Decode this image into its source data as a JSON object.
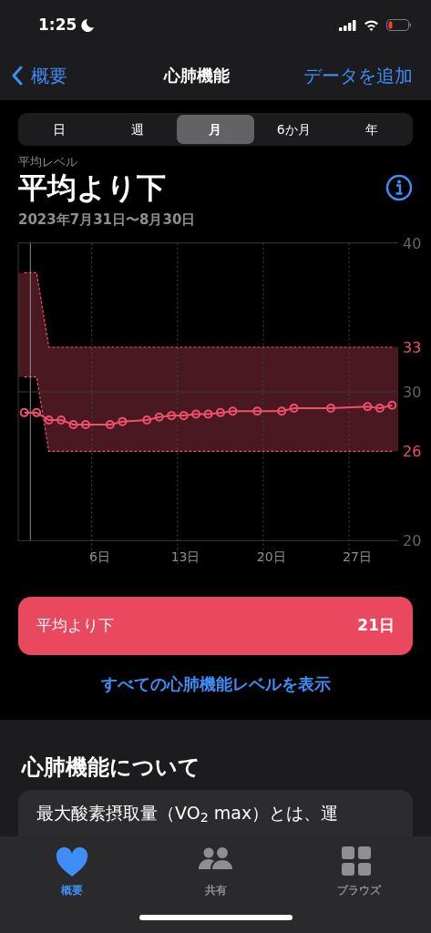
{
  "status_bar": {
    "time": "1:25"
  },
  "nav": {
    "back": "概要",
    "title": "心肺機能",
    "action": "データを追加"
  },
  "segments": [
    {
      "label": "日",
      "selected": false
    },
    {
      "label": "週",
      "selected": false
    },
    {
      "label": "月",
      "selected": true
    },
    {
      "label": "6か月",
      "selected": false
    },
    {
      "label": "年",
      "selected": false
    }
  ],
  "summary": {
    "caption": "平均レベル",
    "level": "平均より下",
    "date_range": "2023年7月31日〜8月30日"
  },
  "chart_data": {
    "type": "line",
    "x": [
      0,
      1,
      2,
      3,
      4,
      5,
      6,
      7,
      8,
      9,
      10,
      11,
      12,
      13,
      14,
      15,
      16,
      17,
      18,
      19,
      20,
      21,
      22,
      23,
      24,
      25,
      26,
      27,
      28,
      29,
      30
    ],
    "xlim": [
      -0.5,
      30.5
    ],
    "ylim": [
      20,
      40
    ],
    "yticks": [
      20,
      {
        "value": 26,
        "label": "26"
      },
      30,
      {
        "value": 33,
        "label": "33"
      },
      40
    ],
    "xticks": [
      {
        "value": 6,
        "label": "6日"
      },
      {
        "value": 13,
        "label": "13日"
      },
      {
        "value": 20,
        "label": "20日"
      },
      {
        "value": 27,
        "label": "27日"
      }
    ],
    "series": [
      {
        "color": "#f0506a",
        "marker": "circle",
        "values": [
          28.6,
          28.6,
          28.1,
          28.1,
          27.8,
          27.8,
          null,
          27.8,
          28.0,
          null,
          28.1,
          28.3,
          28.4,
          28.4,
          28.5,
          28.5,
          28.6,
          28.7,
          null,
          28.7,
          null,
          28.7,
          28.9,
          null,
          null,
          28.9,
          null,
          null,
          29.0,
          28.9,
          29.1
        ]
      },
      {
        "color": "#f0506a",
        "line_style": "dashed",
        "values": [
          38,
          38,
          33,
          33,
          33,
          33,
          33,
          33,
          33,
          33,
          33,
          33,
          33,
          33,
          33,
          33,
          33,
          33,
          33,
          33,
          33,
          33,
          33,
          33,
          33,
          33,
          33,
          33,
          33,
          33,
          33
        ]
      },
      {
        "color": "#f0506a",
        "line_style": "dashed",
        "values": [
          31,
          31,
          26,
          26,
          26,
          26,
          26,
          26,
          26,
          26,
          26,
          26,
          26,
          26,
          26,
          26,
          26,
          26,
          26,
          26,
          26,
          26,
          26,
          26,
          26,
          26,
          26,
          26,
          26,
          26,
          26
        ]
      }
    ]
  },
  "level_row": {
    "label": "平均より下",
    "count": "21日"
  },
  "show_all_link": "すべての心肺機能レベルを表示",
  "about": {
    "heading": "心肺機能について",
    "text": "最大酸素摂取量（VO$_{2}$ max）とは、運"
  },
  "tab_bar": [
    {
      "label": "概要",
      "kind": "heart",
      "selected": true
    },
    {
      "label": "共有",
      "kind": "people",
      "selected": false
    },
    {
      "label": "ブラウズ",
      "kind": "grid",
      "selected": false
    }
  ]
}
